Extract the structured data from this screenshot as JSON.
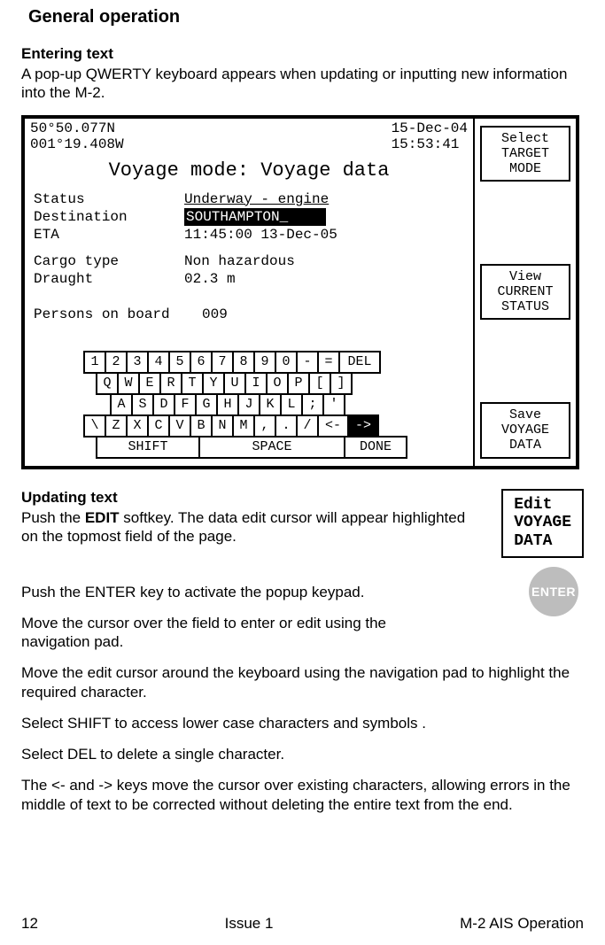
{
  "heading": "General operation",
  "s1": {
    "title": "Entering text",
    "para": "A pop-up QWERTY keyboard appears when updating or inputting new information into the M-2."
  },
  "shot": {
    "lat": "50°50.077N",
    "lon": "001°19.408W",
    "date": "15-Dec-04",
    "time": "15:53:41",
    "title": "Voyage mode: Voyage data",
    "status_lbl": "Status",
    "status_val": "Underway - engine",
    "dest_lbl": "Destination",
    "dest_val": "SOUTHAMPTON_",
    "eta_lbl": "ETA",
    "eta_val": "11:45:00 13-Dec-05",
    "cargo_lbl": "Cargo type",
    "cargo_val": "Non hazardous",
    "draught_lbl": "Draught",
    "draught_val": "02.3 m",
    "persons_lbl": "Persons on board",
    "persons_val": "009",
    "softkeys": {
      "a": "Select\nTARGET\nMODE",
      "b": "View\nCURRENT\nSTATUS",
      "c": "Save\nVOYAGE\nDATA"
    },
    "kbd": {
      "r1": [
        "1",
        "2",
        "3",
        "4",
        "5",
        "6",
        "7",
        "8",
        "9",
        "0",
        "-",
        "=",
        "DEL"
      ],
      "r2": [
        "Q",
        "W",
        "E",
        "R",
        "T",
        "Y",
        "U",
        "I",
        "O",
        "P",
        "[",
        "]"
      ],
      "r3": [
        "A",
        "S",
        "D",
        "F",
        "G",
        "H",
        "J",
        "K",
        "L",
        ";",
        "'"
      ],
      "r4": [
        "\\",
        "Z",
        "X",
        "C",
        "V",
        "B",
        "N",
        "M",
        ",",
        ".",
        "/",
        "<-",
        "->"
      ],
      "r5": [
        "SHIFT",
        "SPACE",
        "DONE"
      ]
    }
  },
  "s2": {
    "title": "Updating text",
    "softkey": "Edit\nVOYAGE\nDATA",
    "enter": "ENTER",
    "p1": "Push the ",
    "p1b": "EDIT",
    "p1c": " softkey. The data edit cursor will appear highlighted on the topmost field of the page.",
    "p2": "Push the ENTER key to activate the popup keypad.",
    "p3": "Move the cursor over the field to enter or edit using the navigation pad.",
    "p4": "Move the edit cursor around the keyboard using the navigation pad to highlight the required character.",
    "p5": "Select SHIFT to access lower case characters and symbols .",
    "p6": "Select DEL to delete a single character.",
    "p7": "The <- and -> keys move the cursor over existing characters, allowing errors in the middle of text to be corrected without deleting the entire text from the end."
  },
  "footer": {
    "left": "12",
    "center": "Issue 1",
    "right": "M-2 AIS Operation"
  }
}
